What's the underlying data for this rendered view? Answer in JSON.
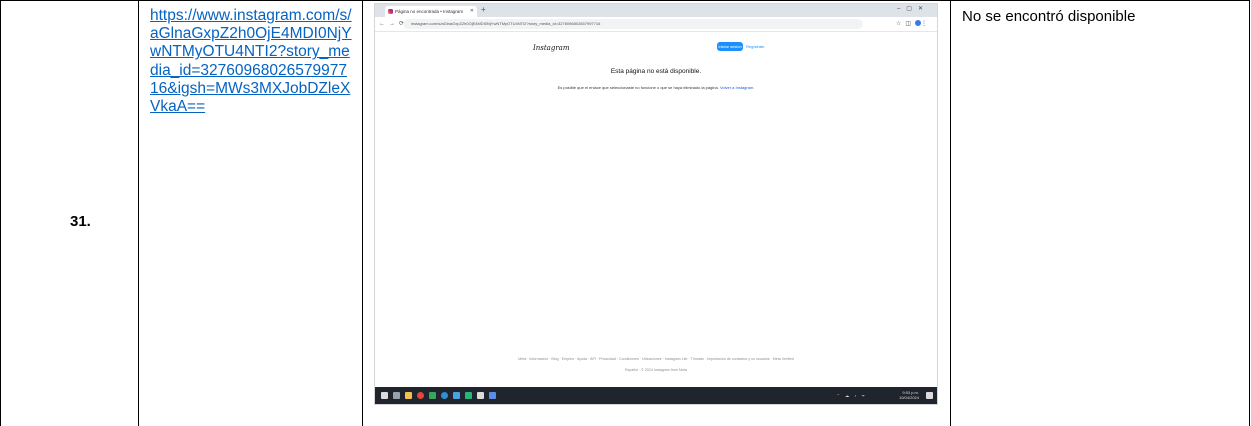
{
  "row": {
    "number": "31.",
    "link": "https://www.instagram.com/s/aGlnaGxpZ2h0OjE4MDI0NjYwNTMyOTU4NTI2?story_media_id=3276096802657997716&igsh=MWs3MXJobDZleXVkaA==",
    "result": "No se encontró disponible"
  },
  "screenshot": {
    "tab_title": "Página no encontrada • Instagram",
    "url": "instagram.com/s/aGlnaGxpZ2h0OjE4MDI0NjYwNTMyOTU4NTI2?story_media_id=3276096802657997716",
    "logo": "Instagram",
    "login_label": "Iniciar sesión",
    "signup_label": "Regístrate",
    "error_title": "Esta página no está disponible.",
    "error_body": "Es posible que el enlace que seleccionaste no funcione o que se haya eliminado la página.",
    "error_link": "Volver a Instagram.",
    "footer_links": "Meta · Información · Blog · Empleo · Ayuda · API · Privacidad · Condiciones · Ubicaciones · Instagram Lite · Threads · Importación de contactos y no usuarios · Meta Verified",
    "footer_copy": "Español · © 2024 Instagram from Meta",
    "clock_time": "9:53 p.m.",
    "clock_date": "10/04/2024"
  }
}
